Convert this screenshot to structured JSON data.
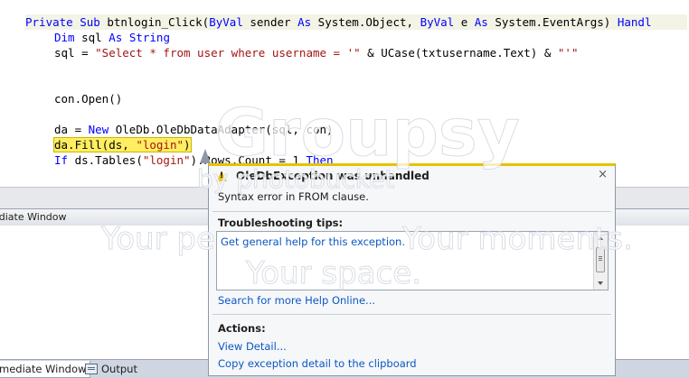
{
  "editor": {
    "line1": {
      "k1": "Private Sub",
      "t1": " btnlogin_Click(",
      "k2": "ByVal",
      "t2": " sender ",
      "k3": "As",
      "t3": " System.Object, ",
      "k4": "ByVal",
      "t4": " e ",
      "k5": "As",
      "t5": " System.EventArgs) ",
      "k6": "Handl"
    },
    "line2": {
      "k1": "Dim",
      "t1": " sql ",
      "k2": "As",
      "t2": " ",
      "k3": "String"
    },
    "line3": {
      "t1": "sql = ",
      "s1": "\"Select * from user where username = '\"",
      "t2": " & UCase(txtusername.Text) & ",
      "s2": "\"'\""
    },
    "line4": {
      "t1": "con.Open()"
    },
    "line5": {
      "t1": "da = ",
      "k1": "New",
      "t2": " OleDb.OleDbDataAdapter(sql, con)"
    },
    "line6": {
      "t1": "da.Fill(ds, ",
      "s1": "\"login\"",
      "t2": ")"
    },
    "line7": {
      "k1": "If",
      "t1": " ds.Tables(",
      "s1": "\"login\"",
      "t2": ").Rows.Count = 1 ",
      "k2": "Then"
    }
  },
  "immediate": {
    "header": "ediate Window",
    "tabs": {
      "immediate": "mediate Window",
      "output": "Output"
    }
  },
  "exception": {
    "title": "OleDbException was unhandled",
    "close": "×",
    "message": "Syntax error in FROM clause.",
    "tips_heading": "Troubleshooting tips:",
    "tip_link": "Get general help for this exception.",
    "search_link": "Search for more Help Online...",
    "actions_heading": "Actions:",
    "action_view": "View Detail...",
    "action_copy": "Copy exception detail to the clipboard"
  },
  "watermark": {
    "brand": "Groupsy",
    "by": "by photobucket",
    "line1": "Your pe",
    "line1b": "Your moments.",
    "line2": "Your space."
  },
  "colors": {
    "keyword": "#0000ff",
    "string": "#a31515",
    "highlight": "#ffee62",
    "link": "#0b57c2",
    "warning": "#f2c200"
  }
}
